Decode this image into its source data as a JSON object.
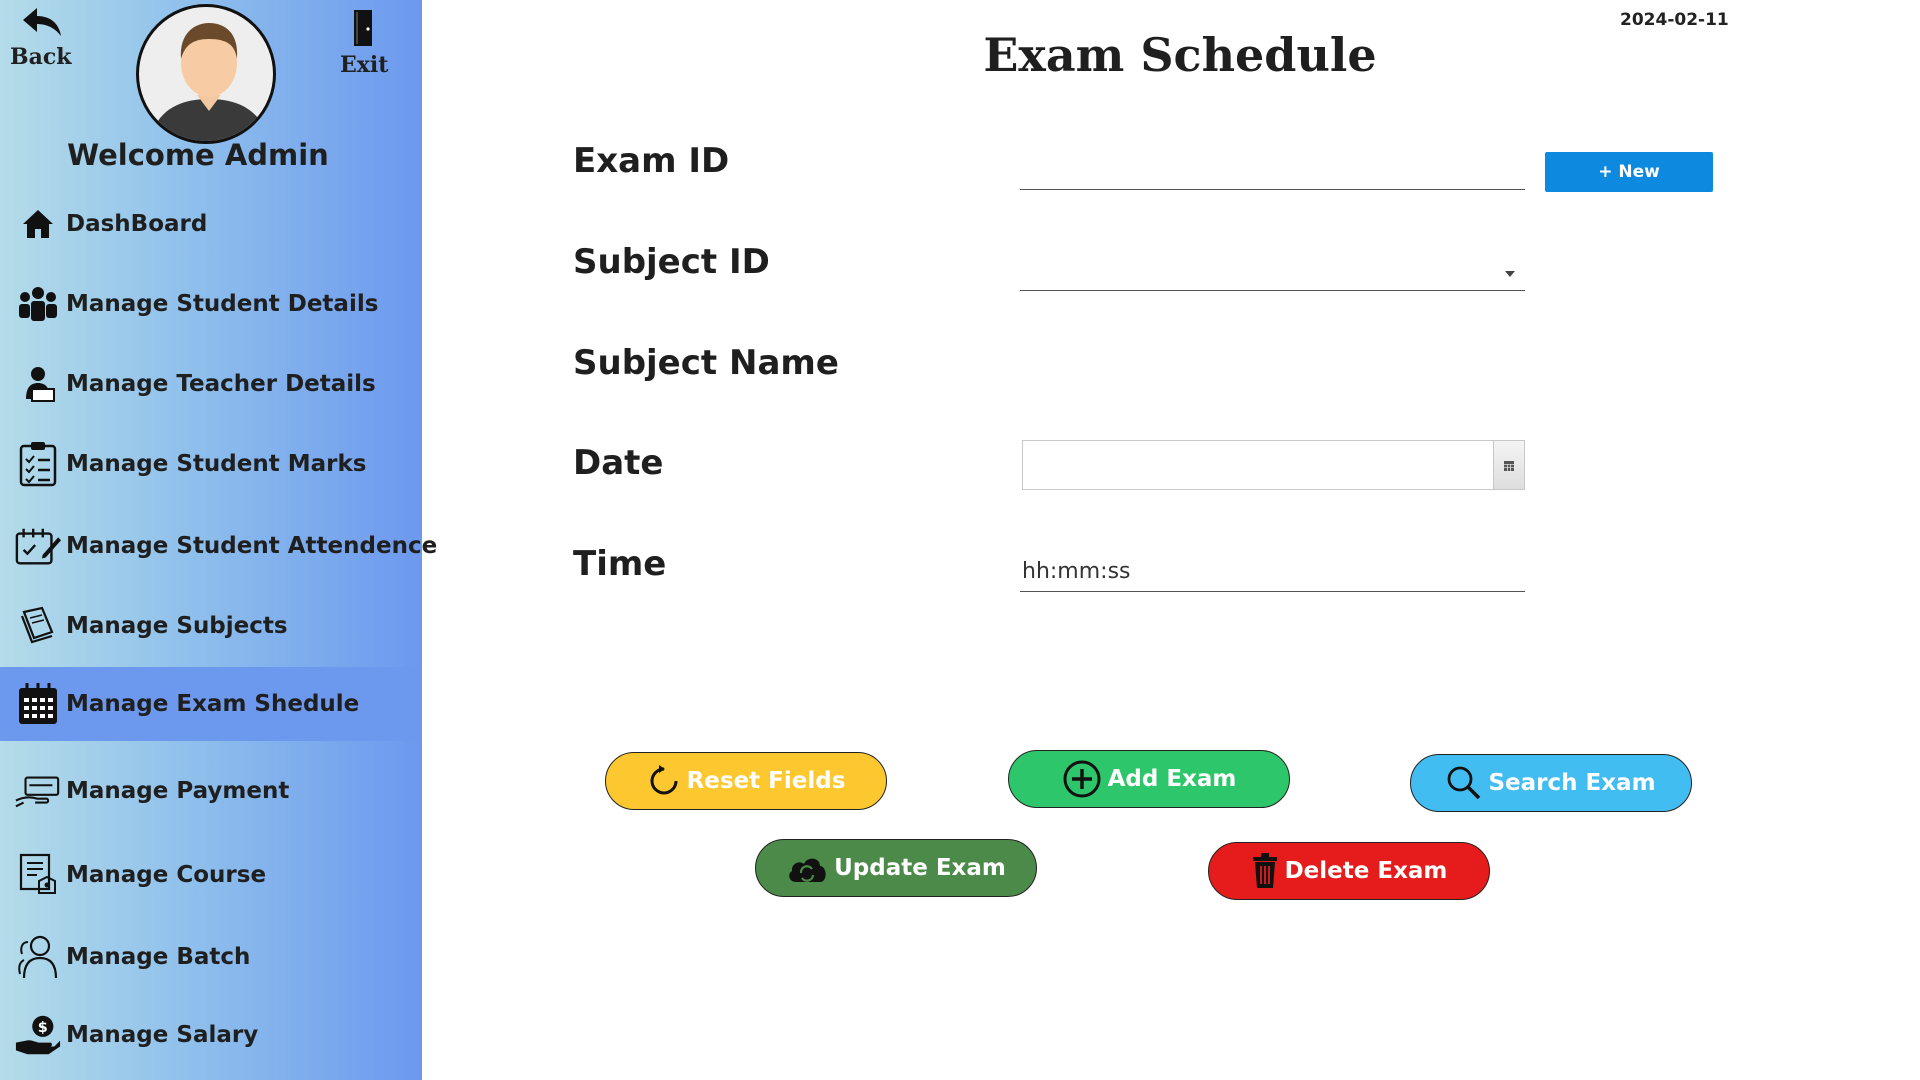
{
  "header": {
    "back_label": "Back",
    "exit_label": "Exit",
    "welcome": "Welcome Admin"
  },
  "sidebar": {
    "items": [
      {
        "label": "DashBoard",
        "icon": "home-icon"
      },
      {
        "label": "Manage Student Details",
        "icon": "users-icon"
      },
      {
        "label": "Manage Teacher Details",
        "icon": "teacher-icon"
      },
      {
        "label": "Manage Student Marks",
        "icon": "checklist-icon"
      },
      {
        "label": "Manage Student Attendence",
        "icon": "attendance-icon"
      },
      {
        "label": "Manage Subjects",
        "icon": "book-icon"
      },
      {
        "label": "Manage Exam Shedule",
        "icon": "calendar-icon",
        "active": true
      },
      {
        "label": "Manage Payment",
        "icon": "payment-icon"
      },
      {
        "label": "Manage Course",
        "icon": "course-icon"
      },
      {
        "label": "Manage Batch",
        "icon": "batch-icon"
      },
      {
        "label": "Manage Salary",
        "icon": "salary-icon"
      }
    ],
    "active_color": "#6c98ee"
  },
  "main": {
    "date": "2024-02-11",
    "title": "Exam Schedule",
    "form": {
      "exam_id_label": "Exam ID",
      "exam_id_value": "",
      "new_button": "+ New",
      "subject_id_label": "Subject ID",
      "subject_id_value": "",
      "subject_name_label": "Subject Name",
      "subject_name_value": "",
      "date_label": "Date",
      "date_value": "",
      "time_label": "Time",
      "time_value": "hh:mm:ss"
    },
    "buttons": {
      "reset": "Reset Fields",
      "add": "Add Exam",
      "search": "Search Exam",
      "update": "Update Exam",
      "delete": "Delete Exam"
    }
  },
  "colors": {
    "reset": "#fdc82f",
    "add": "#2ec66a",
    "search": "#42bdf2",
    "update": "#4c8a4a",
    "delete": "#e61c1c",
    "new_button": "#0d8ae0"
  }
}
